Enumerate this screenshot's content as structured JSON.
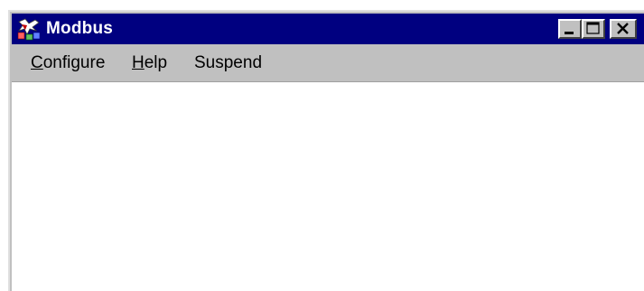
{
  "window": {
    "title": "Modbus",
    "icon": "modbus-app-icon",
    "titlebar_color": "#000080",
    "buttons": [
      "minimize-icon",
      "maximize-icon",
      "close-icon"
    ]
  },
  "menu": {
    "items": [
      {
        "label": "Configure",
        "accel": "C"
      },
      {
        "label": "Help",
        "accel": "H"
      },
      {
        "label": "Suspend",
        "accel": ""
      }
    ]
  }
}
